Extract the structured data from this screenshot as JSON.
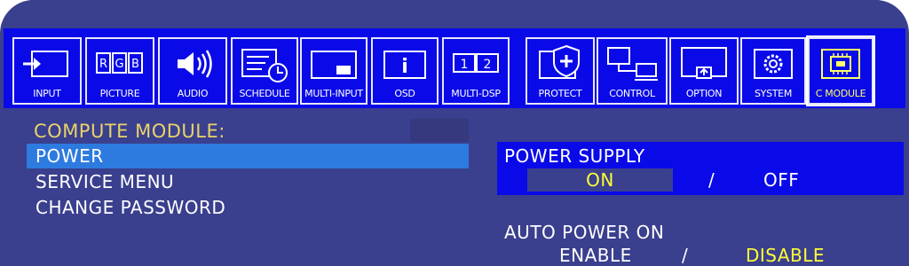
{
  "toolbar": {
    "items": [
      {
        "label": "INPUT",
        "icon": "input-icon"
      },
      {
        "label": "PICTURE",
        "icon": "rgb-icon"
      },
      {
        "label": "AUDIO",
        "icon": "speaker-icon"
      },
      {
        "label": "SCHEDULE",
        "icon": "schedule-icon"
      },
      {
        "label": "MULTI-INPUT",
        "icon": "multi-input-icon"
      },
      {
        "label": "OSD",
        "icon": "info-icon"
      },
      {
        "label": "MULTI-DSP",
        "icon": "multi-dsp-icon"
      },
      {
        "label": "PROTECT",
        "icon": "shield-icon"
      },
      {
        "label": "CONTROL",
        "icon": "network-icon"
      },
      {
        "label": "OPTION",
        "icon": "option-icon"
      },
      {
        "label": "SYSTEM",
        "icon": "gear-icon"
      },
      {
        "label": "C MODULE",
        "icon": "chip-icon"
      }
    ],
    "active": "C MODULE",
    "icon_text": {
      "rgb": [
        "R",
        "G",
        "B"
      ],
      "osd": "i",
      "multi_dsp": [
        "1",
        "2"
      ]
    }
  },
  "left": {
    "title": "COMPUTE MODULE:",
    "items": [
      "POWER",
      "SERVICE MENU",
      "CHANGE PASSWORD"
    ],
    "selected": "POWER"
  },
  "right": {
    "power_supply": {
      "label": "POWER SUPPLY",
      "on": "ON",
      "separator": "/",
      "off": "OFF",
      "selected": "ON"
    },
    "auto_power_on": {
      "label": "AUTO POWER ON",
      "enable": "ENABLE",
      "separator": "/",
      "disable": "DISABLE",
      "selected": "DISABLE"
    }
  },
  "colors": {
    "toolbar_bg": "#0a0ae8",
    "panel_bg": "#3a3f8e",
    "selection": "#2e7be0",
    "highlight_text": "#ffff33",
    "title_text": "#e8d36a"
  }
}
